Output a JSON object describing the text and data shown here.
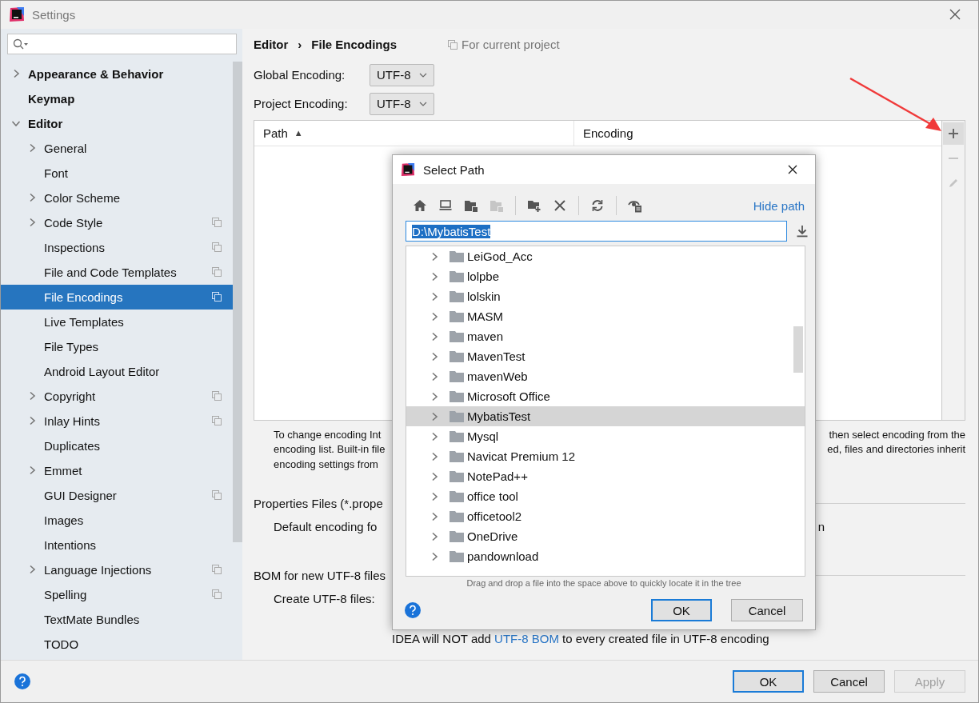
{
  "window": {
    "title": "Settings"
  },
  "sidebar": {
    "items": [
      {
        "label": "Appearance & Behavior",
        "expanded": false,
        "selected": false,
        "project_scope": false
      },
      {
        "label": "Keymap",
        "selected": false,
        "project_scope": false
      },
      {
        "label": "Editor",
        "expanded": true,
        "selected": false,
        "project_scope": false,
        "children": [
          {
            "label": "General",
            "expanded": false,
            "selected": false,
            "project_scope": false
          },
          {
            "label": "Font",
            "selected": false,
            "project_scope": false
          },
          {
            "label": "Color Scheme",
            "expanded": false,
            "selected": false,
            "project_scope": false
          },
          {
            "label": "Code Style",
            "expanded": false,
            "selected": false,
            "project_scope": true
          },
          {
            "label": "Inspections",
            "selected": false,
            "project_scope": true
          },
          {
            "label": "File and Code Templates",
            "selected": false,
            "project_scope": true
          },
          {
            "label": "File Encodings",
            "selected": true,
            "project_scope": true
          },
          {
            "label": "Live Templates",
            "selected": false,
            "project_scope": false
          },
          {
            "label": "File Types",
            "selected": false,
            "project_scope": false
          },
          {
            "label": "Android Layout Editor",
            "selected": false,
            "project_scope": false
          },
          {
            "label": "Copyright",
            "expanded": false,
            "selected": false,
            "project_scope": true
          },
          {
            "label": "Inlay Hints",
            "expanded": false,
            "selected": false,
            "project_scope": true
          },
          {
            "label": "Duplicates",
            "selected": false,
            "project_scope": false
          },
          {
            "label": "Emmet",
            "expanded": false,
            "selected": false,
            "project_scope": false
          },
          {
            "label": "GUI Designer",
            "selected": false,
            "project_scope": true
          },
          {
            "label": "Images",
            "selected": false,
            "project_scope": false
          },
          {
            "label": "Intentions",
            "selected": false,
            "project_scope": false
          },
          {
            "label": "Language Injections",
            "expanded": false,
            "selected": false,
            "project_scope": true
          },
          {
            "label": "Spelling",
            "selected": false,
            "project_scope": true
          },
          {
            "label": "TextMate Bundles",
            "selected": false,
            "project_scope": false
          },
          {
            "label": "TODO",
            "selected": false,
            "project_scope": false
          }
        ]
      }
    ]
  },
  "breadcrumb": [
    "Editor",
    "›",
    "File Encodings"
  ],
  "scope_note": "For current project",
  "encodings": [
    {
      "label": "Global Encoding:",
      "value": "UTF-8"
    },
    {
      "label": "Project Encoding:",
      "value": "UTF-8"
    }
  ],
  "table": {
    "columns": [
      {
        "label": "Path",
        "sort": "▲"
      },
      {
        "label": "Encoding"
      }
    ]
  },
  "side_tools": [
    {
      "kind": "add",
      "disabled": false
    },
    {
      "kind": "remove",
      "disabled": true
    },
    {
      "kind": "edit",
      "disabled": true
    }
  ],
  "description": [
    {
      "left": "To change encoding Int",
      "right": "then select encoding from the"
    },
    {
      "left": "encoding list. Built-in file",
      "right": "ed, files and directories inherit"
    },
    {
      "left": "encoding settings from"
    }
  ],
  "properties_section": {
    "title": "Properties Files (*.prope",
    "default_left": "Default encoding fo",
    "default_right": "n"
  },
  "bom_section": {
    "title": "BOM for new UTF-8 files",
    "create_label": "Create UTF-8 files:",
    "note_before": "IDEA will NOT add ",
    "note_link": "UTF-8 BOM",
    "note_after": " to every created file in UTF-8 encoding"
  },
  "buttons": [
    {
      "label": "OK",
      "kind": "default",
      "disabled": false
    },
    {
      "label": "Cancel",
      "kind": "normal",
      "disabled": false
    },
    {
      "label": "Apply",
      "kind": "normal",
      "disabled": true
    }
  ],
  "dialog": {
    "title": "Select Path",
    "toolbar": [
      {
        "kind": "home",
        "disabled": false
      },
      {
        "kind": "desktop",
        "disabled": false
      },
      {
        "kind": "project",
        "disabled": false
      },
      {
        "kind": "module",
        "disabled": true
      },
      {
        "kind": "sep"
      },
      {
        "kind": "new-folder",
        "disabled": false
      },
      {
        "kind": "delete",
        "disabled": false
      },
      {
        "kind": "sep"
      },
      {
        "kind": "refresh",
        "disabled": false
      },
      {
        "kind": "sep"
      },
      {
        "kind": "hidden",
        "disabled": false
      }
    ],
    "hide_path": "Hide path",
    "path": "D:\\MybatisTest",
    "folders": [
      {
        "name": "LeiGod_Acc",
        "selected": false
      },
      {
        "name": "lolpbe",
        "selected": false
      },
      {
        "name": "lolskin",
        "selected": false
      },
      {
        "name": "MASM",
        "selected": false
      },
      {
        "name": "maven",
        "selected": false
      },
      {
        "name": "MavenTest",
        "selected": false
      },
      {
        "name": "mavenWeb",
        "selected": false
      },
      {
        "name": "Microsoft Office",
        "selected": false
      },
      {
        "name": "MybatisTest",
        "selected": true
      },
      {
        "name": "Mysql",
        "selected": false
      },
      {
        "name": "Navicat Premium 12",
        "selected": false
      },
      {
        "name": "NotePad++",
        "selected": false
      },
      {
        "name": "office tool",
        "selected": false
      },
      {
        "name": "officetool2",
        "selected": false
      },
      {
        "name": "OneDrive",
        "selected": false
      },
      {
        "name": "pandownload",
        "selected": false
      }
    ],
    "hint": "Drag and drop a file into the space above to quickly locate it in the tree",
    "buttons": [
      {
        "label": "OK",
        "kind": "default"
      },
      {
        "label": "Cancel",
        "kind": "normal"
      }
    ]
  }
}
